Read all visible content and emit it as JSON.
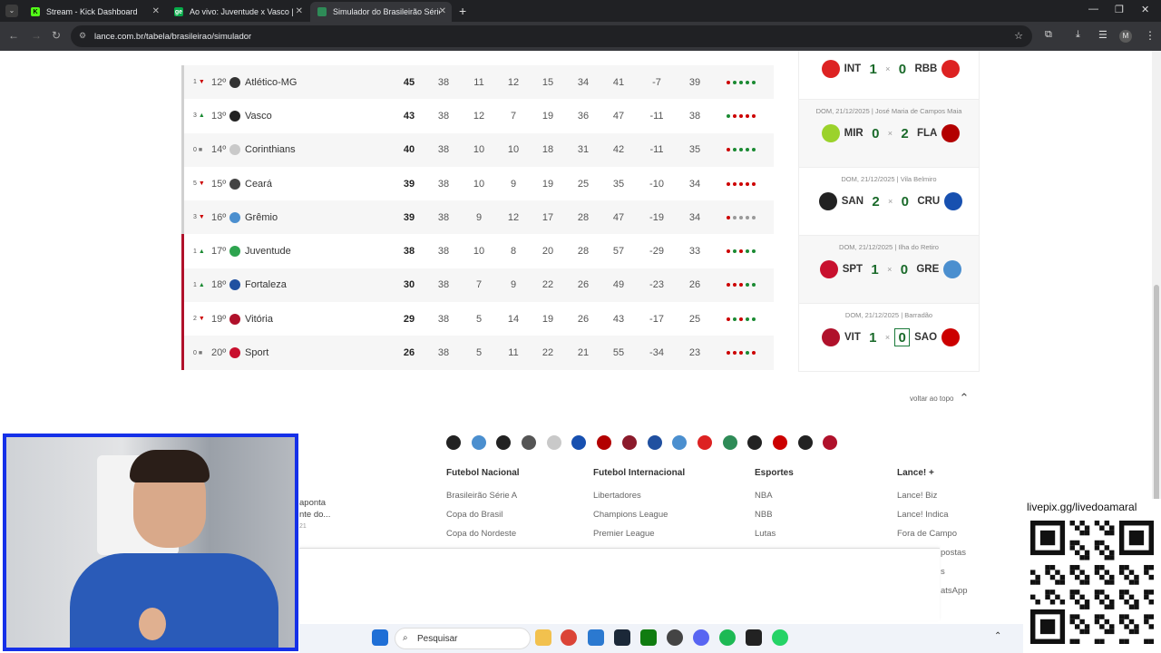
{
  "browser": {
    "tabs": [
      {
        "title": "Stream - Kick Dashboard",
        "fav": "#53fc18",
        "fl": "K"
      },
      {
        "title": "Ao vivo: Juventude x Vasco | Re",
        "fav": "#06aa48",
        "fl": "ge"
      },
      {
        "title": "Simulador do Brasileirão Série A",
        "fav": "#2e8b57",
        "fl": ""
      }
    ],
    "url": "lance.com.br/tabela/brasileirao/simulador",
    "profile": "M"
  },
  "table": {
    "rows": [
      {
        "move": "1",
        "dir": "dn",
        "pos": "12º",
        "team": "Atlético-MG",
        "color": "#333",
        "pts": "45",
        "j": "38",
        "v": "11",
        "e": "12",
        "d": "15",
        "gp": "34",
        "gc": "41",
        "sg": "-7",
        "ap": "39",
        "form": [
          "#c00",
          "#1a8a32",
          "#1a8a32",
          "#1a8a32",
          "#1a8a32"
        ]
      },
      {
        "move": "3",
        "dir": "up",
        "pos": "13º",
        "team": "Vasco",
        "color": "#222",
        "pts": "43",
        "j": "38",
        "v": "12",
        "e": "7",
        "d": "19",
        "gp": "36",
        "gc": "47",
        "sg": "-11",
        "ap": "38",
        "form": [
          "#1a8a32",
          "#c00",
          "#c00",
          "#c00",
          "#c00"
        ]
      },
      {
        "move": "0",
        "dir": "eq",
        "pos": "14º",
        "team": "Corinthians",
        "color": "#c9c9c9",
        "pts": "40",
        "j": "38",
        "v": "10",
        "e": "10",
        "d": "18",
        "gp": "31",
        "gc": "42",
        "sg": "-11",
        "ap": "35",
        "form": [
          "#c00",
          "#1a8a32",
          "#1a8a32",
          "#1a8a32",
          "#1a8a32"
        ]
      },
      {
        "move": "5",
        "dir": "dn",
        "pos": "15º",
        "team": "Ceará",
        "color": "#444",
        "pts": "39",
        "j": "38",
        "v": "10",
        "e": "9",
        "d": "19",
        "gp": "25",
        "gc": "35",
        "sg": "-10",
        "ap": "34",
        "form": [
          "#c00",
          "#c00",
          "#c00",
          "#c00",
          "#c00"
        ]
      },
      {
        "move": "3",
        "dir": "dn",
        "pos": "16º",
        "team": "Grêmio",
        "color": "#4b8fcf",
        "pts": "39",
        "j": "38",
        "v": "9",
        "e": "12",
        "d": "17",
        "gp": "28",
        "gc": "47",
        "sg": "-19",
        "ap": "34",
        "form": [
          "#c00",
          "#999",
          "#999",
          "#999",
          "#999"
        ]
      },
      {
        "move": "1",
        "dir": "up",
        "pos": "17º",
        "team": "Juventude",
        "color": "#2ea44f",
        "pts": "38",
        "j": "38",
        "v": "10",
        "e": "8",
        "d": "20",
        "gp": "28",
        "gc": "57",
        "sg": "-29",
        "ap": "33",
        "form": [
          "#c00",
          "#1a8a32",
          "#c00",
          "#1a8a32",
          "#1a8a32"
        ]
      },
      {
        "move": "1",
        "dir": "up",
        "pos": "18º",
        "team": "Fortaleza",
        "color": "#2050a0",
        "pts": "30",
        "j": "38",
        "v": "7",
        "e": "9",
        "d": "22",
        "gp": "26",
        "gc": "49",
        "sg": "-23",
        "ap": "26",
        "form": [
          "#c00",
          "#c00",
          "#c00",
          "#1a8a32",
          "#1a8a32"
        ]
      },
      {
        "move": "2",
        "dir": "dn",
        "pos": "19º",
        "team": "Vitória",
        "color": "#b0112b",
        "pts": "29",
        "j": "38",
        "v": "5",
        "e": "14",
        "d": "19",
        "gp": "26",
        "gc": "43",
        "sg": "-17",
        "ap": "25",
        "form": [
          "#c00",
          "#1a8a32",
          "#c00",
          "#1a8a32",
          "#1a8a32"
        ]
      },
      {
        "move": "0",
        "dir": "eq",
        "pos": "20º",
        "team": "Sport",
        "color": "#c8102e",
        "pts": "26",
        "j": "38",
        "v": "5",
        "e": "11",
        "d": "22",
        "gp": "21",
        "gc": "55",
        "sg": "-34",
        "ap": "23",
        "form": [
          "#c00",
          "#c00",
          "#c00",
          "#1a8a32",
          "#c00"
        ]
      }
    ]
  },
  "games": [
    {
      "date": "",
      "home": "INT",
      "hs": "1",
      "as": "0",
      "away": "RBB",
      "hc": "#d22",
      "ac": "#d22",
      "sel": false
    },
    {
      "date": "DOM, 21/12/2025 | José Maria de Campos Maia",
      "home": "MIR",
      "hs": "0",
      "as": "2",
      "away": "FLA",
      "hc": "#9bd22b",
      "ac": "#b30000",
      "sel": false
    },
    {
      "date": "DOM, 21/12/2025 | Vila Belmiro",
      "home": "SAN",
      "hs": "2",
      "as": "0",
      "away": "CRU",
      "hc": "#222",
      "ac": "#1750b0",
      "sel": false
    },
    {
      "date": "DOM, 21/12/2025 | Ilha do Retiro",
      "home": "SPT",
      "hs": "1",
      "as": "0",
      "away": "GRE",
      "hc": "#c8102e",
      "ac": "#4b8fcf",
      "sel": false
    },
    {
      "date": "DOM, 21/12/2025 | Barradão",
      "home": "VIT",
      "hs": "1",
      "as": "0",
      "away": "SAO",
      "hc": "#b0112b",
      "ac": "#c00",
      "sel": true
    }
  ],
  "voltar": "voltar ao topo",
  "footer_crests": [
    "#222",
    "#4b8fcf",
    "#222",
    "#555",
    "#c9c9c9",
    "#1750b0",
    "#b30000",
    "#8b1a2b",
    "#2050a0",
    "#4b8fcf",
    "#d22",
    "#2e8b57",
    "#222",
    "#c00",
    "#222",
    "#b0112b"
  ],
  "footer": {
    "nacional": {
      "h": "Futebol Nacional",
      "items": [
        "Brasileirão Série A",
        "Copa do Brasil",
        "Copa do Nordeste"
      ]
    },
    "intl": {
      "h": "Futebol Internacional",
      "items": [
        "Libertadores",
        "Champions League",
        "Premier League"
      ]
    },
    "esportes": {
      "h": "Esportes",
      "items": [
        "NBA",
        "NBB",
        "Lutas"
      ]
    },
    "lance": {
      "h": "Lance! +",
      "items": [
        "Lance! Biz",
        "Lance! Indica",
        "Fora de Campo",
        "postas",
        "s",
        "atsApp"
      ]
    }
  },
  "frag": {
    "l1": "aponta",
    "l2": "nte do...",
    "l3": "21"
  },
  "taskbar": {
    "search": "Pesquisar"
  },
  "qr": {
    "text": "livepix.gg/livedoamaral"
  }
}
